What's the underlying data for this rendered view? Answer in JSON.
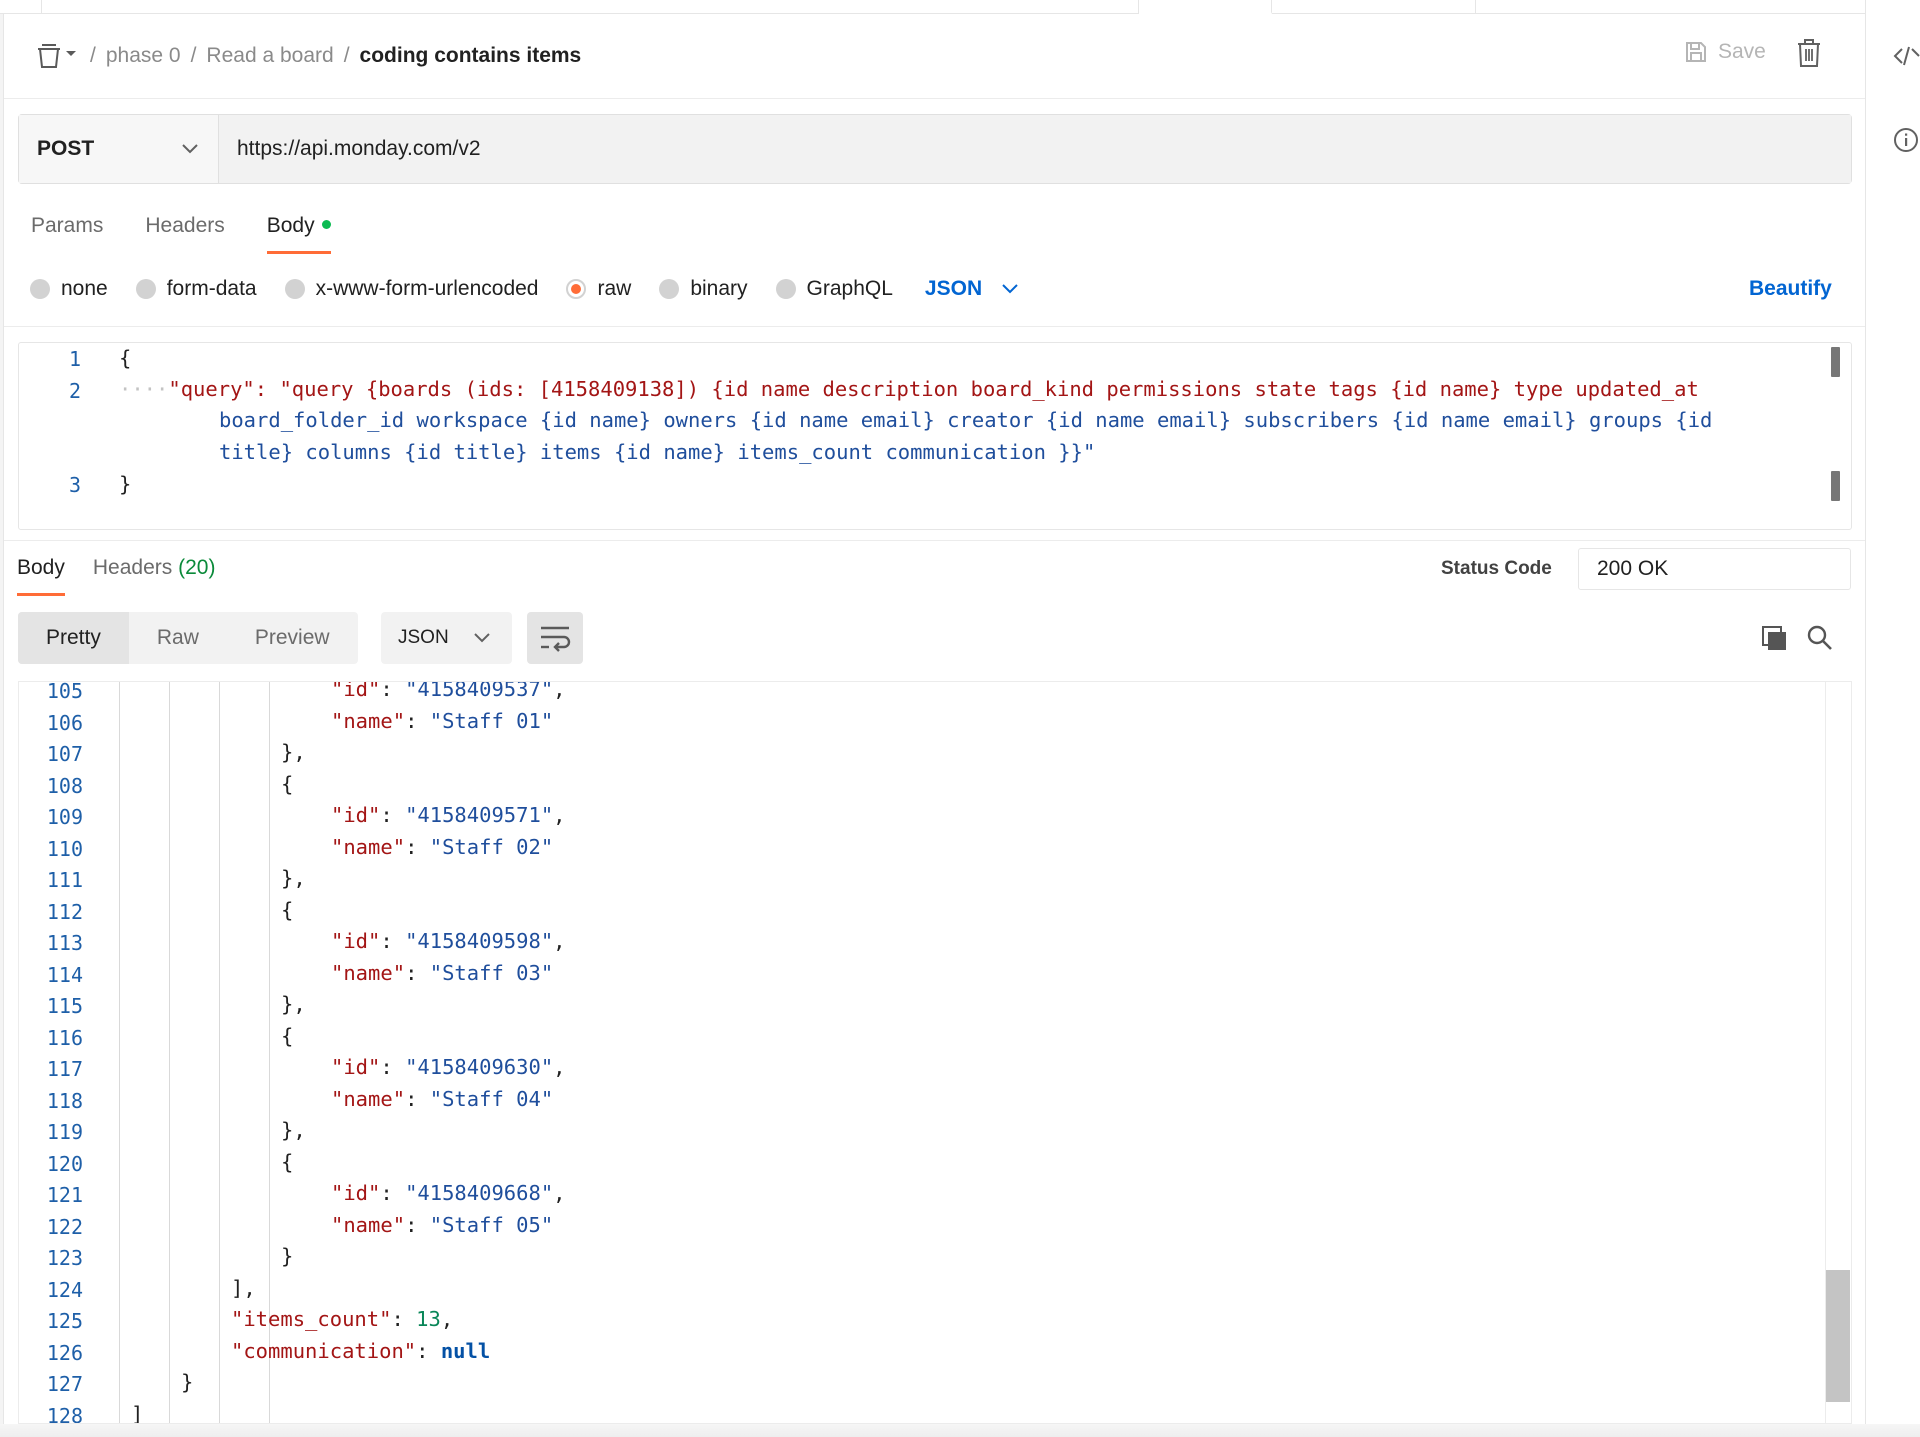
{
  "breadcrumb": {
    "items": [
      "phase 0",
      "Read a board"
    ],
    "current": "coding contains items"
  },
  "header": {
    "save_label": "Save"
  },
  "request": {
    "method": "POST",
    "url": "https://api.monday.com/v2",
    "tabs": [
      "Params",
      "Headers",
      "Body"
    ],
    "active_tab": "Body",
    "body_modes": [
      "none",
      "form-data",
      "x-www-form-urlencoded",
      "raw",
      "binary",
      "GraphQL"
    ],
    "selected_mode": "raw",
    "language": "JSON",
    "beautify_label": "Beautify",
    "editor": {
      "line_numbers": [
        "1",
        "2",
        "3"
      ],
      "lines": [
        "{",
        "\"query\": \"query {boards (ids: [4158409138]) {id name description board_kind permissions state tags {id name} type updated_at",
        "board_folder_id workspace {id name} owners {id name email} creator {id name email} subscribers {id name email} groups {id",
        "title} columns {id title} items {id name} items_count communication }}\"",
        "}"
      ]
    }
  },
  "response": {
    "tabs": {
      "body": "Body",
      "headers": "Headers",
      "headers_count": "(20)"
    },
    "status_label": "Status Code",
    "status_value": "200 OK",
    "view_modes": [
      "Pretty",
      "Raw",
      "Preview"
    ],
    "active_view": "Pretty",
    "language": "JSON",
    "line_numbers": [
      "105",
      "106",
      "107",
      "108",
      "109",
      "110",
      "111",
      "112",
      "113",
      "114",
      "115",
      "116",
      "117",
      "118",
      "119",
      "120",
      "121",
      "122",
      "123",
      "124",
      "125",
      "126",
      "127",
      "128"
    ],
    "items": [
      {
        "id": "4158409537",
        "name": "Staff 01"
      },
      {
        "id": "4158409571",
        "name": "Staff 02"
      },
      {
        "id": "4158409598",
        "name": "Staff 03"
      },
      {
        "id": "4158409630",
        "name": "Staff 04"
      },
      {
        "id": "4158409668",
        "name": "Staff 05"
      }
    ],
    "id_key": "\"id\"",
    "name_key": "\"name\"",
    "items_count_key": "\"items_count\"",
    "items_count_value": "13",
    "communication_key": "\"communication\"",
    "communication_value": "null"
  },
  "icons": [
    "collection-icon",
    "chevron-down-icon",
    "save-icon",
    "trash-icon",
    "code-icon",
    "info-icon",
    "wrap-lines-icon",
    "copy-icon",
    "search-icon"
  ],
  "colors": {
    "accent": "#ff6c37",
    "link": "#0265d2",
    "json_key": "#a31515",
    "json_string": "#1f4e9c",
    "json_number": "#098658",
    "status_green": "#0cbb52"
  }
}
